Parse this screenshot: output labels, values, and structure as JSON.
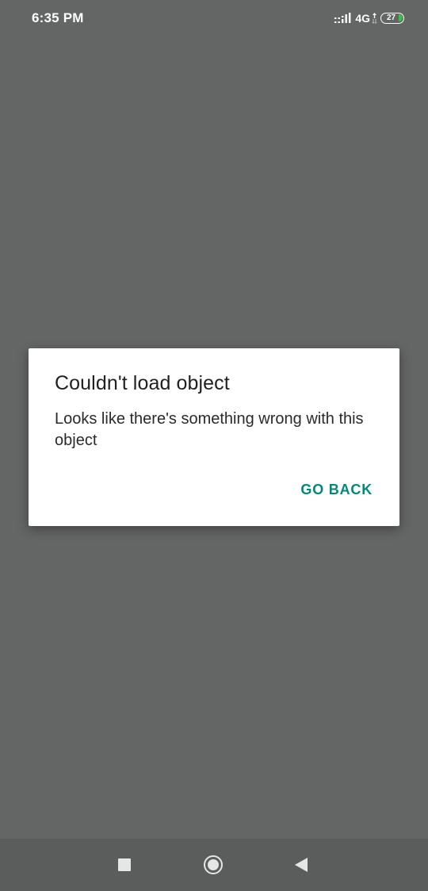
{
  "status_bar": {
    "time": "6:35 PM",
    "network_type": "4G",
    "battery_level": "27",
    "signal_icon": "signal-bars-icon",
    "data_icon": "data-arrows-icon",
    "battery_fill_color": "#32c442"
  },
  "dialog": {
    "title": "Couldn't load object",
    "message": "Looks like there's something wrong with this object",
    "button_label": "GO BACK",
    "button_color": "#00897b"
  },
  "nav_bar": {
    "recents_icon": "square-icon",
    "home_icon": "circle-icon",
    "back_icon": "triangle-back-icon"
  },
  "colors": {
    "background": "#646565",
    "nav_background": "#5b5c5c",
    "dialog_background": "#ffffff"
  }
}
